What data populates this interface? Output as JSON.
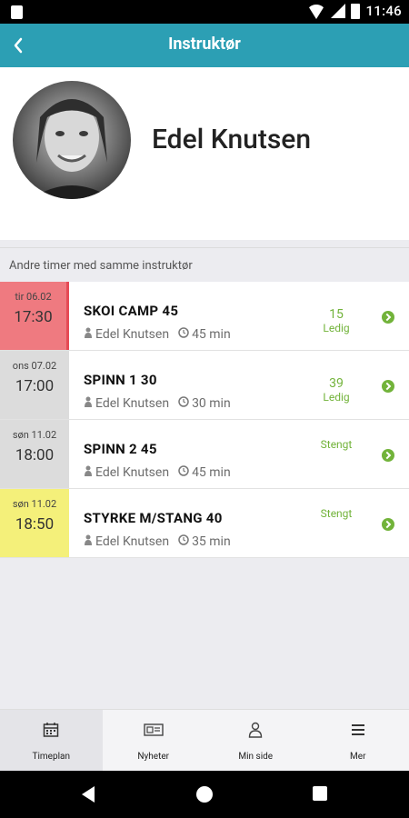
{
  "status_bar": {
    "time": "11:46"
  },
  "app_bar": {
    "title": "Instruktør"
  },
  "profile": {
    "name": "Edel Knutsen"
  },
  "section": {
    "label": "Andre timer med samme instruktør"
  },
  "classes": [
    {
      "day": "tir 06.02",
      "time": "17:30",
      "name": "SKOI CAMP 45",
      "instructor": "Edel Knutsen",
      "duration": "45 min",
      "status_num": "15",
      "status_label": "Ledig",
      "date_color": "#ef7a80"
    },
    {
      "day": "ons 07.02",
      "time": "17:00",
      "name": "SPINN 1 30",
      "instructor": "Edel Knutsen",
      "duration": "30 min",
      "status_num": "39",
      "status_label": "Ledig",
      "date_color": "#dcdcdc"
    },
    {
      "day": "søn 11.02",
      "time": "18:00",
      "name": "SPINN 2 45",
      "instructor": "Edel Knutsen",
      "duration": "45 min",
      "status_num": "",
      "status_label": "Stengt",
      "date_color": "#dcdcdc"
    },
    {
      "day": "søn 11.02",
      "time": "18:50",
      "name": "STYRKE M/STANG 40",
      "instructor": "Edel Knutsen",
      "duration": "35 min",
      "status_num": "",
      "status_label": "Stengt",
      "date_color": "#f4f07a"
    }
  ],
  "bottom_nav": [
    {
      "label": "Timeplan",
      "icon": "calendar-icon",
      "active": true
    },
    {
      "label": "Nyheter",
      "icon": "news-icon",
      "active": false
    },
    {
      "label": "Min side",
      "icon": "user-icon",
      "active": false
    },
    {
      "label": "Mer",
      "icon": "menu-icon",
      "active": false
    }
  ],
  "colors": {
    "header": "#2c9fb4",
    "accent_green": "#72b33a",
    "highlight_red": "#e54a55"
  }
}
